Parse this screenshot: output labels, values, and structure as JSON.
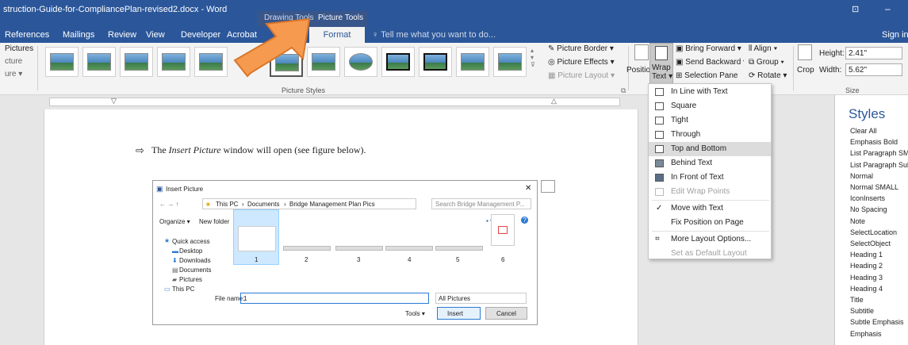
{
  "titlebar": {
    "doc_title": "struction-Guide-for-CompliancePlan-revised2.docx - Word",
    "context_tabs": [
      "Drawing Tools",
      "Picture Tools"
    ],
    "sign_in": "Sign in"
  },
  "tabs": [
    "References",
    "Mailings",
    "Review",
    "View",
    "Developer",
    "Acrobat"
  ],
  "format_tab": "Format",
  "tell_me": "Tell me what you want to do...",
  "ribbon": {
    "left_items": [
      "Pictures",
      "cture",
      "ure ▾"
    ],
    "group_picture_styles": "Picture Styles",
    "picture_border": "Picture Border ▾",
    "picture_effects": "Picture Effects ▾",
    "picture_layout": "Picture Layout ▾",
    "position": "Position",
    "wrap_text": "Wrap Text ▾",
    "bring_forward": "Bring Forward ▾",
    "send_backward": "Send Backward ▾",
    "selection_pane": "Selection Pane",
    "align": "Align ▾",
    "group": "Group ▾",
    "rotate": "Rotate ▾",
    "crop": "Crop",
    "height_label": "Height:",
    "height_value": "2.41\"",
    "width_label": "Width:",
    "width_value": "5.62\"",
    "size_group": "Size"
  },
  "wrap_menu": [
    {
      "label": "In Line with Text",
      "disabled": false
    },
    {
      "label": "Square",
      "disabled": false
    },
    {
      "label": "Tight",
      "disabled": false
    },
    {
      "label": "Through",
      "disabled": false
    },
    {
      "label": "Top and Bottom",
      "disabled": false,
      "highlighted": true
    },
    {
      "label": "Behind Text",
      "disabled": false
    },
    {
      "label": "In Front of Text",
      "disabled": false
    },
    {
      "label": "Edit Wrap Points",
      "disabled": true
    },
    {
      "label": "Move with Text",
      "disabled": false,
      "checked": true
    },
    {
      "label": "Fix Position on Page",
      "disabled": false
    },
    {
      "label": "More Layout Options...",
      "disabled": false
    },
    {
      "label": "Set as Default Layout",
      "disabled": true
    }
  ],
  "document": {
    "bullet": "⇨",
    "sentence_pre": "The ",
    "sentence_em": "Insert Picture",
    "sentence_post": " window will open (see figure below)."
  },
  "dialog": {
    "title": "Insert Picture",
    "breadcrumb": [
      "This PC",
      "Documents",
      "Bridge Management Plan Pics"
    ],
    "search_placeholder": "Search Bridge Management P...",
    "organize": "Organize ▾",
    "new_folder": "New folder",
    "nav": [
      "Quick access",
      "Desktop",
      "Downloads",
      "Documents",
      "Pictures",
      "This PC"
    ],
    "thumbs": [
      "1",
      "2",
      "3",
      "4",
      "5",
      "6"
    ],
    "file_name_label": "File name:",
    "file_name_value": "1",
    "filter": "All Pictures",
    "tools": "Tools ▾",
    "insert": "Insert",
    "cancel": "Cancel"
  },
  "styles_pane": {
    "title": "Styles",
    "items": [
      "Clear All",
      "Emphasis Bold",
      "List Paragraph SMA",
      "List Paragraph Subs",
      "Normal",
      "Normal SMALL",
      "IconInserts",
      "No Spacing",
      "Note",
      "SelectLocation",
      "SelectObject",
      "Heading 1",
      "Heading 2",
      "Heading 3",
      "Heading 4",
      "Title",
      "Subtitle",
      "Subtle Emphasis",
      "Emphasis"
    ]
  },
  "colors": {
    "accent": "#2b579a",
    "highlight": "#dcdcdc",
    "arrow": "#f59a4f"
  }
}
